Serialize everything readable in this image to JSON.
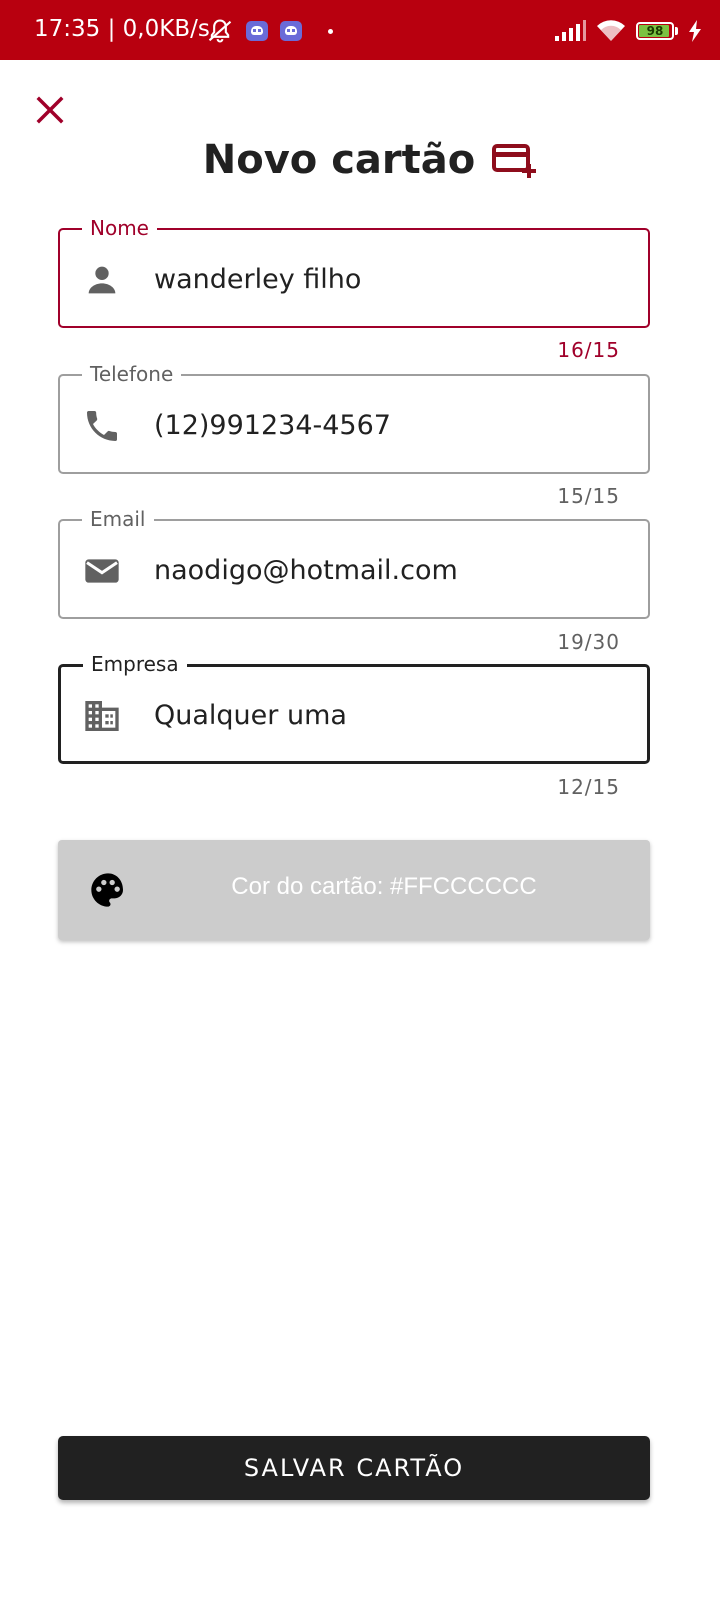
{
  "status_bar": {
    "time_speed": "17:35 | 0,0KB/s",
    "battery_level": "98"
  },
  "header": {
    "title": "Novo cartão",
    "close_icon": "close-icon",
    "title_icon": "credit-card-add-icon"
  },
  "form": {
    "name": {
      "label": "Nome",
      "value": "wanderley filho",
      "counter": "16/15",
      "icon": "person-icon"
    },
    "phone": {
      "label": "Telefone",
      "value": "(12)991234-4567",
      "counter": "15/15",
      "icon": "phone-icon"
    },
    "email": {
      "label": "Email",
      "value": "naodigo@hotmail.com",
      "counter": "19/30",
      "icon": "email-icon"
    },
    "company": {
      "label": "Empresa",
      "value": "Qualquer uma",
      "counter": "12/15",
      "icon": "building-icon"
    }
  },
  "color_button": {
    "label": "Cor do cartão: #FFCCCCCC",
    "color": "#cccccc",
    "icon": "palette-icon"
  },
  "save_button": {
    "label": "SALVAR CARTÃO"
  },
  "colors": {
    "status_bar": "#b8000f",
    "accent": "#a0002a",
    "dark": "#212121"
  }
}
